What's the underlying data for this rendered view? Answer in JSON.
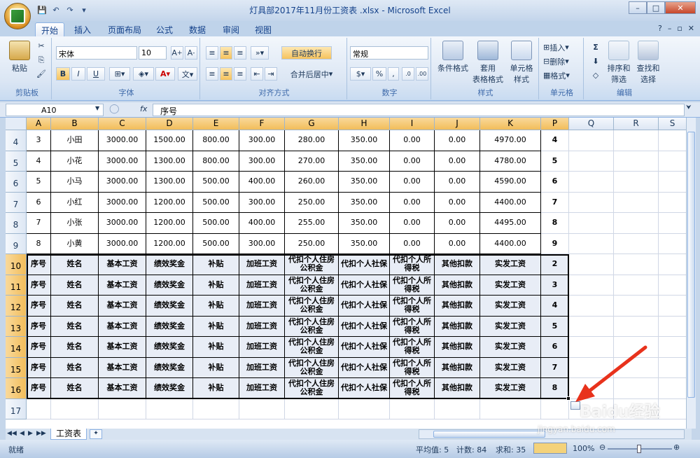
{
  "window": {
    "title": "灯具部2017年11月份工资表 .xlsx - Microsoft Excel"
  },
  "tabs": [
    "开始",
    "插入",
    "页面布局",
    "公式",
    "数据",
    "审阅",
    "视图"
  ],
  "ribbon": {
    "clipboard": {
      "label": "剪贴板",
      "paste": "粘贴"
    },
    "font": {
      "label": "字体",
      "name": "宋体",
      "size": "10",
      "bold": "B",
      "italic": "I",
      "underline": "U"
    },
    "align": {
      "label": "对齐方式",
      "wrap": "自动换行",
      "merge": "合并后居中"
    },
    "number": {
      "label": "数字",
      "format": "常规",
      "percent": "%",
      "comma": ","
    },
    "styles": {
      "label": "样式",
      "cond": "条件格式",
      "table": "套用表格格式",
      "cell": "单元格样式",
      "table_l1": "套用",
      "table_l2": "表格格式",
      "cell_l1": "单元格",
      "cell_l2": "样式"
    },
    "cells": {
      "label": "单元格",
      "insert": "插入",
      "delete": "删除",
      "format": "格式"
    },
    "editing": {
      "label": "编辑",
      "sort_l1": "排序和",
      "sort_l2": "筛选",
      "find_l1": "查找和",
      "find_l2": "选择",
      "sigma": "Σ"
    }
  },
  "formula": {
    "cell_ref": "A10",
    "content": "序号",
    "fx": "fx"
  },
  "columns": [
    "A",
    "B",
    "C",
    "D",
    "E",
    "F",
    "G",
    "H",
    "I",
    "J",
    "K",
    "P",
    "Q",
    "R",
    "S"
  ],
  "rows": [
    {
      "num": "4",
      "cells": [
        "3",
        "小田",
        "3000.00",
        "1500.00",
        "800.00",
        "300.00",
        "280.00",
        "350.00",
        "0.00",
        "0.00",
        "4970.00",
        "4"
      ]
    },
    {
      "num": "5",
      "cells": [
        "4",
        "小花",
        "3000.00",
        "1300.00",
        "800.00",
        "300.00",
        "270.00",
        "350.00",
        "0.00",
        "0.00",
        "4780.00",
        "5"
      ]
    },
    {
      "num": "6",
      "cells": [
        "5",
        "小马",
        "3000.00",
        "1300.00",
        "500.00",
        "400.00",
        "260.00",
        "350.00",
        "0.00",
        "0.00",
        "4590.00",
        "6"
      ]
    },
    {
      "num": "7",
      "cells": [
        "6",
        "小红",
        "3000.00",
        "1200.00",
        "500.00",
        "300.00",
        "250.00",
        "350.00",
        "0.00",
        "0.00",
        "4400.00",
        "7"
      ]
    },
    {
      "num": "8",
      "cells": [
        "7",
        "小张",
        "3000.00",
        "1200.00",
        "500.00",
        "400.00",
        "255.00",
        "350.00",
        "0.00",
        "0.00",
        "4495.00",
        "8"
      ]
    },
    {
      "num": "9",
      "cells": [
        "8",
        "小黄",
        "3000.00",
        "1200.00",
        "500.00",
        "300.00",
        "250.00",
        "350.00",
        "0.00",
        "0.00",
        "4400.00",
        "9"
      ]
    }
  ],
  "header_rows": [
    {
      "num": "10",
      "p": "2"
    },
    {
      "num": "11",
      "p": "3"
    },
    {
      "num": "12",
      "p": "4"
    },
    {
      "num": "13",
      "p": "5"
    },
    {
      "num": "14",
      "p": "6"
    },
    {
      "num": "15",
      "p": "7"
    },
    {
      "num": "16",
      "p": "8"
    }
  ],
  "header_labels": [
    "序号",
    "姓名",
    "基本工资",
    "绩效奖金",
    "补贴",
    "加班工资",
    "代扣个人住房公积金",
    "代扣个人社保",
    "代扣个人所得税",
    "其他扣款",
    "实发工资"
  ],
  "row17": "17",
  "sheet": {
    "name": "工资表"
  },
  "status": {
    "ready": "就绪",
    "avg": "平均值: 5",
    "count": "计数: 84",
    "sum": "求和: 35",
    "zoom": "100%"
  },
  "watermark": {
    "brand": "Baidu经验",
    "url": "jingyan.baidu.com"
  },
  "colors": {
    "accent": "#15428b",
    "selection": "#f2bd5a",
    "arrow": "#e8321c"
  }
}
